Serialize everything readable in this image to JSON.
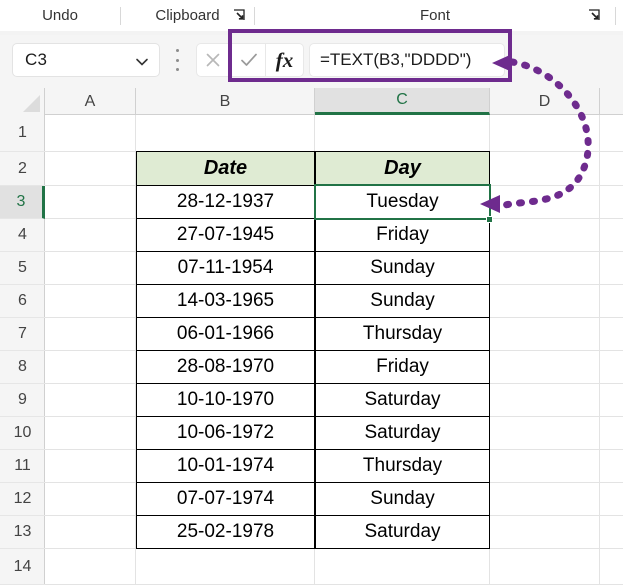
{
  "ribbon": {
    "groups": [
      {
        "label": "Undo",
        "launcher": false,
        "icon": ""
      },
      {
        "label": "Clipboard",
        "launcher": true,
        "icon": "dialog-launcher-icon"
      },
      {
        "label": "Font",
        "launcher": true,
        "icon": "dialog-launcher-icon"
      }
    ]
  },
  "formula_bar": {
    "name_box_value": "C3",
    "name_box_dropdown_icon": "chevron-down-icon",
    "more_icon": "more-vertical-icon",
    "cancel_icon": "close-icon",
    "enter_icon": "checkmark-icon",
    "insert_function_icon": "fx-icon",
    "insert_function_label": "fx",
    "formula_value": "=TEXT(B3,\"DDDD\")",
    "formula_placeholder": ""
  },
  "grid": {
    "column_headers": [
      "A",
      "B",
      "C",
      "D"
    ],
    "selected_column": "C",
    "row_headers": [
      "1",
      "2",
      "3",
      "4",
      "5",
      "6",
      "7",
      "8",
      "9",
      "10",
      "11",
      "12",
      "13",
      "14"
    ],
    "selected_row": "3",
    "active_cell": "C3"
  },
  "table": {
    "headers": [
      "Date",
      "Day"
    ],
    "header_fill": "#dfebd3",
    "rows": [
      {
        "date": "28-12-1937",
        "day": "Tuesday"
      },
      {
        "date": "27-07-1945",
        "day": "Friday"
      },
      {
        "date": "07-11-1954",
        "day": "Sunday"
      },
      {
        "date": "14-03-1965",
        "day": "Sunday"
      },
      {
        "date": "06-01-1966",
        "day": "Thursday"
      },
      {
        "date": "28-08-1970",
        "day": "Friday"
      },
      {
        "date": "10-10-1970",
        "day": "Saturday"
      },
      {
        "date": "10-06-1972",
        "day": "Saturday"
      },
      {
        "date": "10-01-1974",
        "day": "Thursday"
      },
      {
        "date": "07-07-1974",
        "day": "Sunday"
      },
      {
        "date": "25-02-1978",
        "day": "Saturday"
      }
    ]
  },
  "annotation": {
    "color": "#6e2b8e",
    "shape": "dotted-curved-double-arrow",
    "highlight_color": "#6e2b8e"
  },
  "colors": {
    "selection_green": "#217346",
    "header_green": "#dfebd3",
    "annotation_purple": "#6e2b8e",
    "grid_line": "#e3e3e3"
  }
}
